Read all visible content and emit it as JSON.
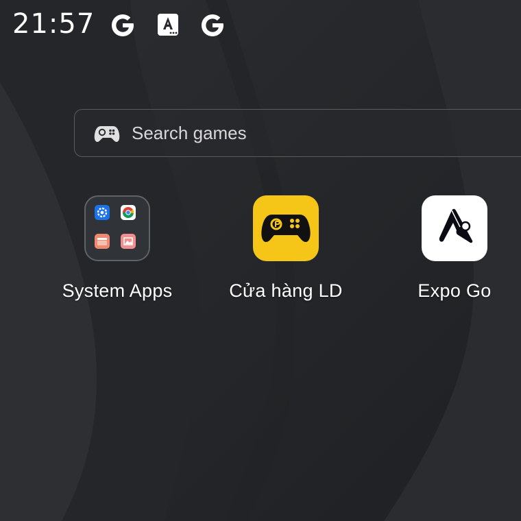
{
  "status_bar": {
    "time": "21:57",
    "icons": [
      "google-g-icon",
      "accessibility-a-icon",
      "google-g-icon"
    ]
  },
  "search": {
    "placeholder": "Search games",
    "icon": "gamepad-icon"
  },
  "apps": [
    {
      "label": "System Apps",
      "icon": "folder-icon"
    },
    {
      "label": "Cửa hàng LD",
      "icon": "ld-store-gamepad-icon",
      "color": "#f5c518"
    },
    {
      "label": "Expo Go",
      "icon": "expo-go-icon",
      "color": "#ffffff"
    }
  ],
  "folder_contents": [
    "settings-icon",
    "chrome-icon",
    "file-manager-icon",
    "gallery-icon"
  ],
  "colors": {
    "background": "#26282b",
    "ld_yellow": "#f5c518"
  }
}
